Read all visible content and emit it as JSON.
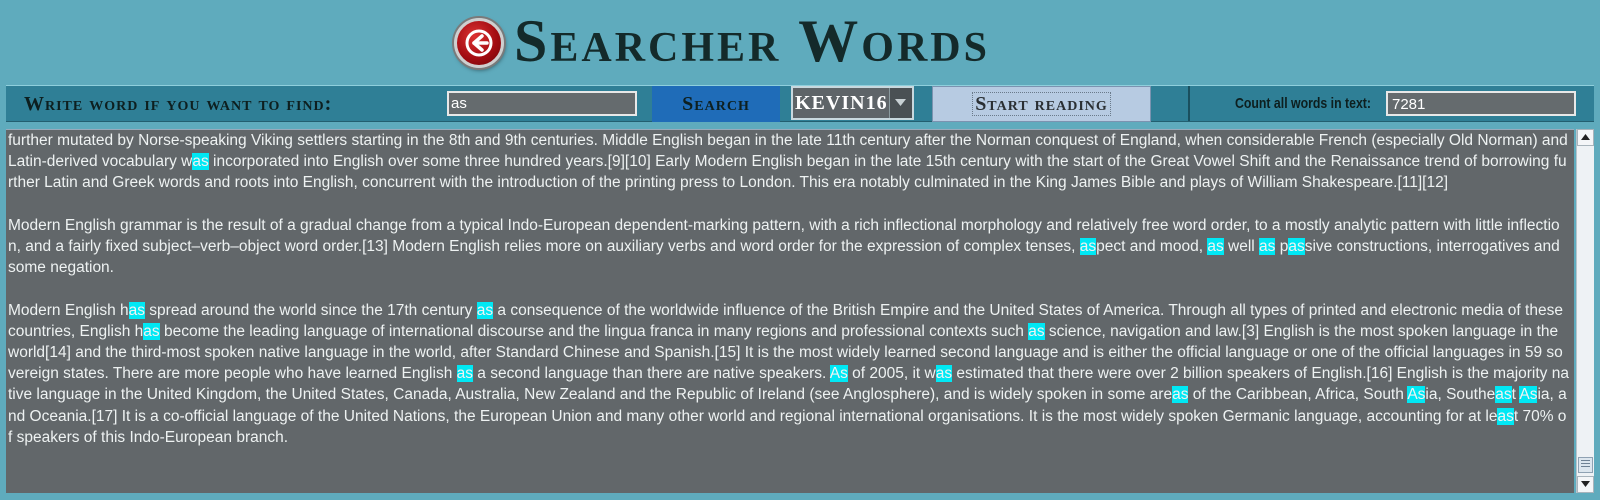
{
  "header": {
    "title": "Searcher Words",
    "back_icon": "arrow-left-icon"
  },
  "toolbar": {
    "find_label": "Write word if you want to find:",
    "search_value": "as",
    "search_button": "Search",
    "user_selected": "KEVIN16",
    "start_button": "Start reading",
    "count_label": "Count all words in text:",
    "count_value": "7281"
  },
  "colors": {
    "background": "#5fabbd",
    "toolbar": "#2f7f96",
    "search_button": "#1f6cb8",
    "text_area": "#62676a",
    "highlight": "#00e8f4"
  },
  "text_area": {
    "highlight_word": "as",
    "paragraphs": [
      " further mutated by Norse-speaking Viking settlers starting in the 8th and 9th centuries. Middle English began in the late 11th century after the Norman conquest of England, when considerable French (especially Old Norman) and Latin-derived vocabulary was incorporated into English over some three hundred years.[9][10] Early Modern English began in the late 15th century with the start of the Great Vowel Shift and the Renaissance trend of borrowing further Latin and Greek words and roots into English, concurrent with the introduction of the printing press to London. This era notably culminated in the King James Bible and plays of William Shakespeare.[11][12]",
      "Modern English grammar is the result of a gradual change from a typical Indo-European dependent-marking pattern, with a rich inflectional morphology and relatively free word order, to a mostly analytic pattern with little inflection, and a fairly fixed subject–verb–object word order.[13] Modern English relies more on auxiliary verbs and word order for the expression of complex tenses, aspect and mood, as well as passive constructions, interrogatives and some negation.",
      "Modern English has spread around the world since the 17th century as a consequence of the worldwide influence of the British Empire and the United States of America. Through all types of printed and electronic media of these countries, English has become the leading language of international discourse and the lingua franca in many regions and professional contexts such as science, navigation and law.[3] English is the most spoken language in the world[14] and the third-most spoken native language in the world, after Standard Chinese and Spanish.[15] It is the most widely learned second language and is either the official language or one of the official languages in 59 sovereign states. There are more people who have learned English as a second language than there are native speakers. As of 2005, it was estimated that there were over 2 billion speakers of English.[16] English is the majority native language in the United Kingdom, the United States, Canada, Australia, New Zealand and the Republic of Ireland (see Anglosphere), and is widely spoken in some areas of the Caribbean, Africa, South Asia, Southeast Asia, and Oceania.[17] It is a co-official language of the United Nations, the European Union and many other world and regional international organisations. It is the most widely spoken Germanic language, accounting for at least 70% of speakers of this Indo-European branch."
    ]
  }
}
